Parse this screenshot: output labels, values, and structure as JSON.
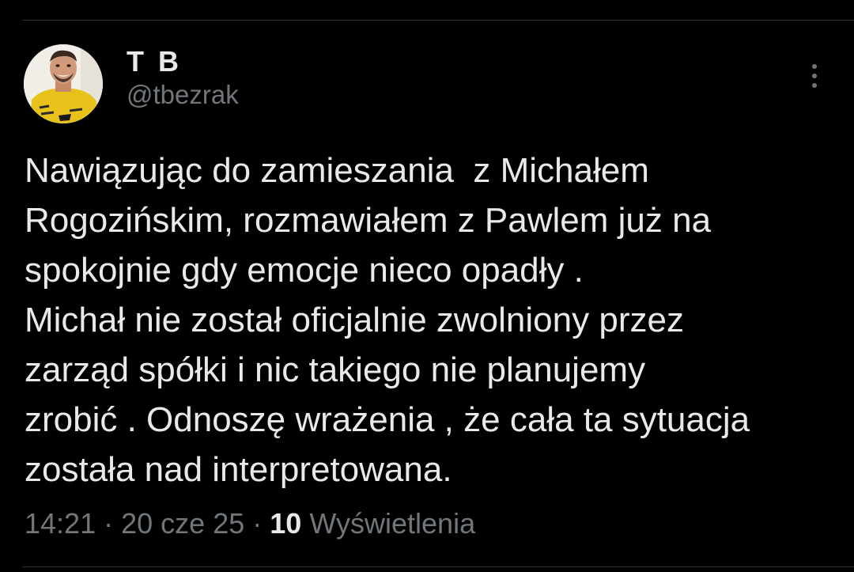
{
  "tweet": {
    "author": {
      "display_name": "T B",
      "handle": "@tbezrak"
    },
    "menu_icon": "more-vertical-icon",
    "text_lines": [
      "Nawiązując do zamieszania  z Michałem",
      "Rogozińskim, rozmawiałem z Pawlem już na",
      "spokojnie gdy emocje nieco opadły .",
      "Michał nie został oficjalnie zwolniony przez",
      "zarząd spółki i nic takiego nie planujemy",
      "zrobić . Odnoszę wrażenia , że cała ta sytuacja",
      "została nad interpretowana."
    ],
    "meta": {
      "time": "14:21",
      "separator": "·",
      "date": "20 cze 25",
      "views_count": "10",
      "views_label": "Wyświetlenia"
    }
  },
  "colors": {
    "background": "#000000",
    "primary_text": "#e7e9ea",
    "secondary_text": "#71767b",
    "divider": "#2f3336"
  }
}
